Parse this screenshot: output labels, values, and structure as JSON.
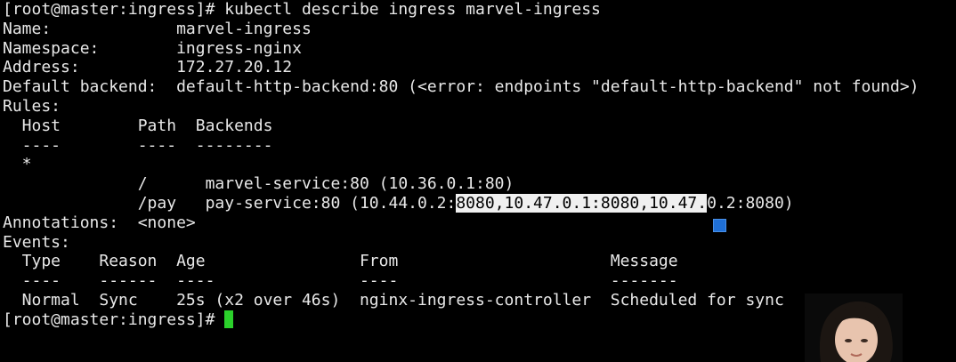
{
  "terminal": {
    "lines": [
      "[root@master:ingress]# kubectl describe ingress marvel-ingress",
      "Name:             marvel-ingress",
      "Namespace:        ingress-nginx",
      "Address:          172.27.20.12",
      "Default backend:  default-http-backend:80 (<error: endpoints \"default-http-backend\" not found>)",
      "Rules:",
      "  Host        Path  Backends",
      "  ----        ----  --------",
      "  *",
      "              /      marvel-service:80 (10.36.0.1:80)",
      "Annotations:  <none>",
      "Events:",
      "  Type    Reason  Age                From                      Message",
      "  ----    ------  ----               ----                      -------",
      "  Normal  Sync    25s (x2 over 46s)  nginx-ingress-controller  Scheduled for sync"
    ],
    "pay_rule": {
      "before_selection": "              /pay   pay-service:80 (10.44.0.2:",
      "selection": "8080,10.47.0.1:8080,10.47.",
      "after_selection": "0.2:8080)"
    },
    "prompt": "[root@master:ingress]# "
  },
  "colors": {
    "background": "#000000",
    "text": "#e8e8e8",
    "selection_bg": "#f0f0f0",
    "cursor": "#2bd12b",
    "marker": "#1f6fd6"
  }
}
